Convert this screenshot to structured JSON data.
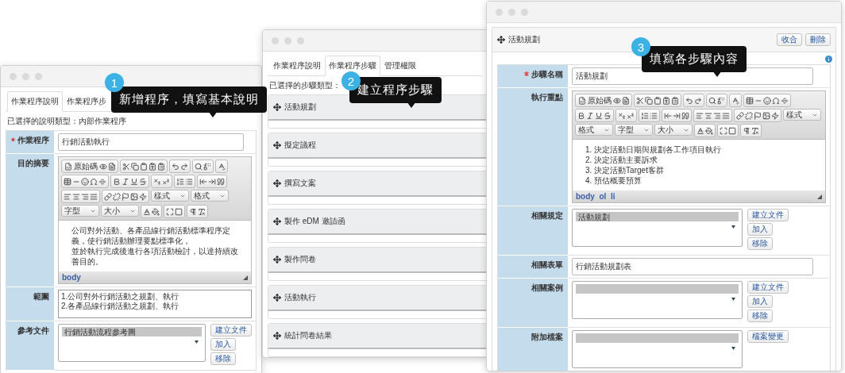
{
  "window_1": {
    "tabs": [
      {
        "label": "作業程序說明",
        "selected": true
      },
      {
        "label": "作業程序步",
        "selected": false
      }
    ],
    "info": "已選擇的說明類型：內部作業程序",
    "fields": [
      {
        "kind": "text",
        "label": "作業程序",
        "required": true,
        "value": "行銷活動執行"
      },
      {
        "kind": "editor",
        "label": "目的摘要",
        "required": false,
        "source_label": "原始碼",
        "dropdowns": [
          "樣式",
          "格式",
          "字型",
          "大小"
        ],
        "content": [
          "公司對外活動、各產品線行銷活動標準程序定義，使行銷活動辦理要點標準化，",
          "並於執行完成後進行各項活動檢討，以達持續改善目的。"
        ],
        "status": "body"
      },
      {
        "kind": "textarea",
        "label": "範圍",
        "required": false,
        "lines": [
          "1.公司對外行銷活動之規劃、執行",
          "2.各產品線行銷活動之規劃、執行"
        ]
      },
      {
        "kind": "list",
        "label": "參考文件",
        "required": false,
        "items": [
          {
            "text": "行銷活動流程參考圖",
            "selected": true
          }
        ],
        "buttons": [
          "建立文件",
          "加入",
          "移除"
        ]
      }
    ]
  },
  "window_2": {
    "tabs": [
      {
        "label": "作業程序說明",
        "selected": false
      },
      {
        "label": "作業程序步驟",
        "selected": true
      },
      {
        "label": "管理權限",
        "selected": false
      }
    ],
    "info": "已選擇的步驟類型：",
    "steps": [
      "活動規劃",
      "擬定議程",
      "撰寫文案",
      "製作 eDM 邀請函",
      "製作問卷",
      "活動執行",
      "統計問卷結果"
    ]
  },
  "window_3": {
    "title": "活動規劃",
    "buttons": [
      "收合",
      "刪除"
    ],
    "fields": [
      {
        "kind": "text",
        "label": "步驟名稱",
        "required": true,
        "value": "活動規劃"
      },
      {
        "kind": "editor",
        "label": "執行重點",
        "required": false,
        "source_label": "原始碼",
        "dropdowns": [
          "樣式",
          "格式",
          "字型",
          "大小"
        ],
        "content": [
          "1.  決定活動日期與規劃各工作項目執行",
          "2.  決定活動主要訴求",
          "3.  決定活動Target客群",
          "4.  預估概要預算"
        ],
        "status": "body  ol  li"
      },
      {
        "kind": "list",
        "label": "相關規定",
        "required": false,
        "items": [
          {
            "text": "活動規劃",
            "selected": true
          }
        ],
        "buttons": [
          "建立文件",
          "加入",
          "移除"
        ]
      },
      {
        "kind": "text",
        "label": "相關表單",
        "required": false,
        "value": "行銷活動規劃表"
      },
      {
        "kind": "list",
        "label": "相關案例",
        "required": false,
        "items": [
          {
            "selected": true
          }
        ],
        "buttons": [
          "建立文件",
          "加入",
          "移除"
        ]
      },
      {
        "kind": "list",
        "label": "附加檔案",
        "required": false,
        "items": [
          {
            "selected": true
          }
        ],
        "buttons": [
          "檔案變更"
        ]
      }
    ]
  },
  "callouts": [
    {
      "number": "1",
      "text": "新增程序，填寫基本說明"
    },
    {
      "number": "2",
      "text": "建立程序步驟"
    },
    {
      "number": "3",
      "text": "填寫各步驟內容"
    }
  ]
}
